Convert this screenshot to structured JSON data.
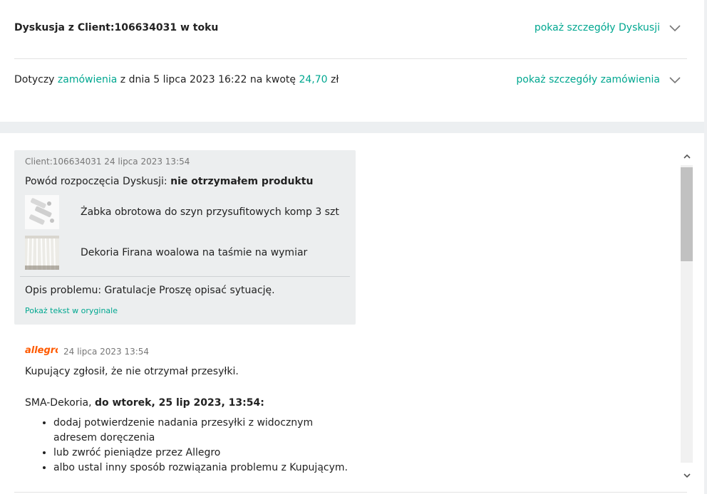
{
  "discussion": {
    "title": "Dyskusja z Client:106634031 w toku",
    "details_toggle": "pokaż szczegóły Dyskusji"
  },
  "order": {
    "prefix": "Dotyczy",
    "order_link": "zamówienia",
    "date_text": "z dnia 5 lipca 2023 16:22 na kwotę",
    "amount": "24,70",
    "currency": "zł",
    "details_toggle": "pokaż szczegóły zamówienia"
  },
  "message": {
    "meta": "Client:106634031 24 lipca 2023 13:54",
    "reason_label": "Powód rozpoczęcia Dyskusji:",
    "reason_value": "nie otrzymałem produktu",
    "products": [
      {
        "name": "Żabka obrotowa do szyn przysufitowych komp 3 szt"
      },
      {
        "name": "Dekoria Firana woalowa na taśmie na wymiar"
      }
    ],
    "description": "Opis problemu: Gratulacje Proszę opisać sytuację.",
    "show_original": "Pokaż tekst w oryginale"
  },
  "system_message": {
    "logo_text": "allegro",
    "time": "24 lipca 2023 13:54",
    "line1": "Kupujący zgłosił, że nie otrzymał przesyłki.",
    "seller": "SMA-Dekoria,",
    "deadline": "do wtorek, 25 lip 2023, 13:54:",
    "bullets": [
      "dodaj potwierdzenie nadania przesyłki z widocznym adresem doręczenia",
      "lub zwróć pieniądze przez Allegro",
      "albo ustal inny sposób rozwiązania problemu z Kupującym."
    ]
  },
  "colors": {
    "accent": "#00a790",
    "brand_allegro": "#ff5a00",
    "card_bg": "#eceeef"
  },
  "icons": {
    "toggle": "chevron-down-icon",
    "scroll_up": "scroll-up-arrow-icon",
    "scroll_down": "scroll-down-arrow-icon"
  }
}
